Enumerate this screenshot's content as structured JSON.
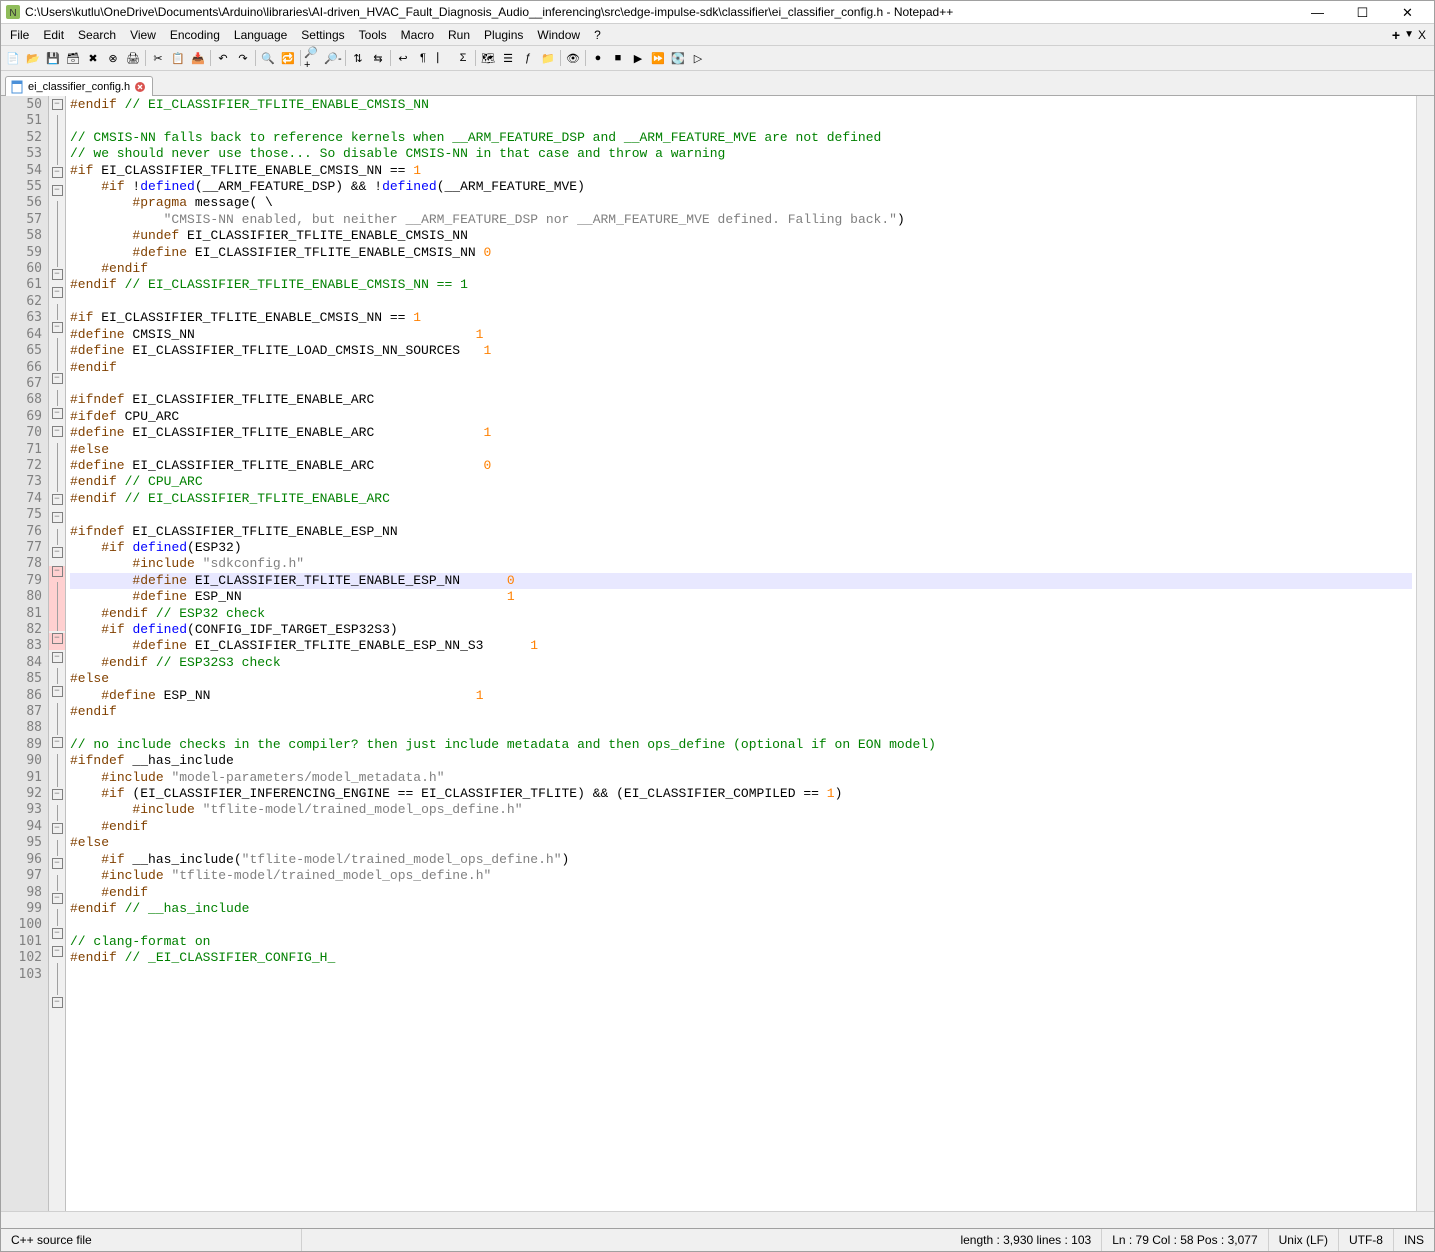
{
  "titlebar": {
    "title": "C:\\Users\\kutlu\\OneDrive\\Documents\\Arduino\\libraries\\AI-driven_HVAC_Fault_Diagnosis_Audio__inferencing\\src\\edge-impulse-sdk\\classifier\\ei_classifier_config.h - Notepad++"
  },
  "menu": {
    "items": [
      "File",
      "Edit",
      "Search",
      "View",
      "Encoding",
      "Language",
      "Settings",
      "Tools",
      "Macro",
      "Run",
      "Plugins",
      "Window",
      "?"
    ],
    "plus": "+",
    "caret": "▼",
    "close": "X"
  },
  "tab": {
    "label": "ei_classifier_config.h"
  },
  "editor": {
    "first_line": 50,
    "highlight_line": 79,
    "lines": [
      {
        "n": 50,
        "fold": "-",
        "seg": [
          [
            "pp",
            "#endif"
          ],
          [
            "id",
            " "
          ],
          [
            "cm",
            "// EI_CLASSIFIER_TFLITE_ENABLE_CMSIS_NN"
          ]
        ]
      },
      {
        "n": 51,
        "fold": "|",
        "seg": []
      },
      {
        "n": 52,
        "fold": "|",
        "seg": [
          [
            "cm",
            "// CMSIS-NN falls back to reference kernels when __ARM_FEATURE_DSP and __ARM_FEATURE_MVE are not defined"
          ]
        ]
      },
      {
        "n": 53,
        "fold": "|",
        "seg": [
          [
            "cm",
            "// we should never use those... So disable CMSIS-NN in that case and throw a warning"
          ]
        ]
      },
      {
        "n": 54,
        "fold": "-",
        "seg": [
          [
            "pp",
            "#if"
          ],
          [
            "id",
            " EI_CLASSIFIER_TFLITE_ENABLE_CMSIS_NN == "
          ],
          [
            "num",
            "1"
          ]
        ]
      },
      {
        "n": 55,
        "fold": "-",
        "seg": [
          [
            "id",
            "    "
          ],
          [
            "pp",
            "#if"
          ],
          [
            "id",
            " !"
          ],
          [
            "kw",
            "defined"
          ],
          [
            "id",
            "(__ARM_FEATURE_DSP) && !"
          ],
          [
            "kw",
            "defined"
          ],
          [
            "id",
            "(__ARM_FEATURE_MVE)"
          ]
        ]
      },
      {
        "n": 56,
        "fold": "|",
        "seg": [
          [
            "id",
            "        "
          ],
          [
            "pp",
            "#pragma"
          ],
          [
            "id",
            " message( \\"
          ]
        ]
      },
      {
        "n": 57,
        "fold": "|",
        "seg": [
          [
            "id",
            "            "
          ],
          [
            "str",
            "\"CMSIS-NN enabled, but neither __ARM_FEATURE_DSP nor __ARM_FEATURE_MVE defined. Falling back.\""
          ],
          [
            "id",
            ")"
          ]
        ]
      },
      {
        "n": 58,
        "fold": "|",
        "seg": [
          [
            "id",
            "        "
          ],
          [
            "pp",
            "#undef"
          ],
          [
            "id",
            " EI_CLASSIFIER_TFLITE_ENABLE_CMSIS_NN"
          ]
        ]
      },
      {
        "n": 59,
        "fold": "|",
        "seg": [
          [
            "id",
            "        "
          ],
          [
            "pp",
            "#define"
          ],
          [
            "id",
            " EI_CLASSIFIER_TFLITE_ENABLE_CMSIS_NN "
          ],
          [
            "num",
            "0"
          ]
        ]
      },
      {
        "n": 60,
        "fold": "-",
        "seg": [
          [
            "id",
            "    "
          ],
          [
            "pp",
            "#endif"
          ]
        ]
      },
      {
        "n": 61,
        "fold": "-",
        "seg": [
          [
            "pp",
            "#endif"
          ],
          [
            "id",
            " "
          ],
          [
            "cm",
            "// EI_CLASSIFIER_TFLITE_ENABLE_CMSIS_NN == 1"
          ]
        ]
      },
      {
        "n": 62,
        "fold": "|",
        "seg": []
      },
      {
        "n": 63,
        "fold": "-",
        "seg": [
          [
            "pp",
            "#if"
          ],
          [
            "id",
            " EI_CLASSIFIER_TFLITE_ENABLE_CMSIS_NN == "
          ],
          [
            "num",
            "1"
          ]
        ]
      },
      {
        "n": 64,
        "fold": "|",
        "seg": [
          [
            "pp",
            "#define"
          ],
          [
            "id",
            " CMSIS_NN                                    "
          ],
          [
            "num",
            "1"
          ]
        ]
      },
      {
        "n": 65,
        "fold": "|",
        "seg": [
          [
            "pp",
            "#define"
          ],
          [
            "id",
            " EI_CLASSIFIER_TFLITE_LOAD_CMSIS_NN_SOURCES   "
          ],
          [
            "num",
            "1"
          ]
        ]
      },
      {
        "n": 66,
        "fold": "-",
        "seg": [
          [
            "pp",
            "#endif"
          ]
        ]
      },
      {
        "n": 67,
        "fold": "|",
        "seg": []
      },
      {
        "n": 68,
        "fold": "-",
        "seg": [
          [
            "pp",
            "#ifndef"
          ],
          [
            "id",
            " EI_CLASSIFIER_TFLITE_ENABLE_ARC"
          ]
        ]
      },
      {
        "n": 69,
        "fold": "-",
        "seg": [
          [
            "pp",
            "#ifdef"
          ],
          [
            "id",
            " CPU_ARC"
          ]
        ]
      },
      {
        "n": 70,
        "fold": "|",
        "seg": [
          [
            "pp",
            "#define"
          ],
          [
            "id",
            " EI_CLASSIFIER_TFLITE_ENABLE_ARC              "
          ],
          [
            "num",
            "1"
          ]
        ]
      },
      {
        "n": 71,
        "fold": "|",
        "seg": [
          [
            "pp",
            "#else"
          ]
        ]
      },
      {
        "n": 72,
        "fold": "|",
        "seg": [
          [
            "pp",
            "#define"
          ],
          [
            "id",
            " EI_CLASSIFIER_TFLITE_ENABLE_ARC              "
          ],
          [
            "num",
            "0"
          ]
        ]
      },
      {
        "n": 73,
        "fold": "-",
        "seg": [
          [
            "pp",
            "#endif"
          ],
          [
            "id",
            " "
          ],
          [
            "cm",
            "// CPU_ARC"
          ]
        ]
      },
      {
        "n": 74,
        "fold": "-",
        "seg": [
          [
            "pp",
            "#endif"
          ],
          [
            "id",
            " "
          ],
          [
            "cm",
            "// EI_CLASSIFIER_TFLITE_ENABLE_ARC"
          ]
        ]
      },
      {
        "n": 75,
        "fold": "|",
        "seg": []
      },
      {
        "n": 76,
        "fold": "-",
        "seg": [
          [
            "pp",
            "#ifndef"
          ],
          [
            "id",
            " EI_CLASSIFIER_TFLITE_ENABLE_ESP_NN"
          ]
        ]
      },
      {
        "n": 77,
        "fold": "-r",
        "seg": [
          [
            "id",
            "    "
          ],
          [
            "pp",
            "#if"
          ],
          [
            "id",
            " "
          ],
          [
            "kw",
            "defined"
          ],
          [
            "id",
            "(ESP32)"
          ]
        ]
      },
      {
        "n": 78,
        "fold": "|r",
        "seg": [
          [
            "id",
            "        "
          ],
          [
            "pp",
            "#include"
          ],
          [
            "id",
            " "
          ],
          [
            "str",
            "\"sdkconfig.h\""
          ]
        ]
      },
      {
        "n": 79,
        "fold": "|r",
        "seg": [
          [
            "id",
            "        "
          ],
          [
            "pp",
            "#define"
          ],
          [
            "id",
            " EI_CLASSIFIER_TFLITE_ENABLE_ESP_NN      "
          ],
          [
            "num",
            "0"
          ]
        ]
      },
      {
        "n": 80,
        "fold": "|r",
        "seg": [
          [
            "id",
            "        "
          ],
          [
            "pp",
            "#define"
          ],
          [
            "id",
            " ESP_NN                                  "
          ],
          [
            "num",
            "1"
          ]
        ]
      },
      {
        "n": 81,
        "fold": "-r",
        "seg": [
          [
            "id",
            "    "
          ],
          [
            "pp",
            "#endif"
          ],
          [
            "id",
            " "
          ],
          [
            "cm",
            "// ESP32 check"
          ]
        ]
      },
      {
        "n": 82,
        "fold": "-",
        "seg": [
          [
            "id",
            "    "
          ],
          [
            "pp",
            "#if"
          ],
          [
            "id",
            " "
          ],
          [
            "kw",
            "defined"
          ],
          [
            "id",
            "(CONFIG_IDF_TARGET_ESP32S3)"
          ]
        ]
      },
      {
        "n": 83,
        "fold": "|",
        "seg": [
          [
            "id",
            "        "
          ],
          [
            "pp",
            "#define"
          ],
          [
            "id",
            " EI_CLASSIFIER_TFLITE_ENABLE_ESP_NN_S3      "
          ],
          [
            "num",
            "1"
          ]
        ]
      },
      {
        "n": 84,
        "fold": "-",
        "seg": [
          [
            "id",
            "    "
          ],
          [
            "pp",
            "#endif"
          ],
          [
            "id",
            " "
          ],
          [
            "cm",
            "// ESP32S3 check"
          ]
        ]
      },
      {
        "n": 85,
        "fold": "|",
        "seg": [
          [
            "pp",
            "#else"
          ]
        ]
      },
      {
        "n": 86,
        "fold": "|",
        "seg": [
          [
            "id",
            "    "
          ],
          [
            "pp",
            "#define"
          ],
          [
            "id",
            " ESP_NN                                  "
          ],
          [
            "num",
            "1"
          ]
        ]
      },
      {
        "n": 87,
        "fold": "-",
        "seg": [
          [
            "pp",
            "#endif"
          ]
        ]
      },
      {
        "n": 88,
        "fold": "|",
        "seg": []
      },
      {
        "n": 89,
        "fold": "|",
        "seg": [
          [
            "cm",
            "// no include checks in the compiler? then just include metadata and then ops_define (optional if on EON model)"
          ]
        ]
      },
      {
        "n": 90,
        "fold": "-",
        "seg": [
          [
            "pp",
            "#ifndef"
          ],
          [
            "id",
            " __has_include"
          ]
        ]
      },
      {
        "n": 91,
        "fold": "|",
        "seg": [
          [
            "id",
            "    "
          ],
          [
            "pp",
            "#include"
          ],
          [
            "id",
            " "
          ],
          [
            "str",
            "\"model-parameters/model_metadata.h\""
          ]
        ]
      },
      {
        "n": 92,
        "fold": "-",
        "seg": [
          [
            "id",
            "    "
          ],
          [
            "pp",
            "#if"
          ],
          [
            "id",
            " (EI_CLASSIFIER_INFERENCING_ENGINE == EI_CLASSIFIER_TFLITE) && (EI_CLASSIFIER_COMPILED == "
          ],
          [
            "num",
            "1"
          ],
          [
            "id",
            ")"
          ]
        ]
      },
      {
        "n": 93,
        "fold": "|",
        "seg": [
          [
            "id",
            "        "
          ],
          [
            "pp",
            "#include"
          ],
          [
            "id",
            " "
          ],
          [
            "str",
            "\"tflite-model/trained_model_ops_define.h\""
          ]
        ]
      },
      {
        "n": 94,
        "fold": "-",
        "seg": [
          [
            "id",
            "    "
          ],
          [
            "pp",
            "#endif"
          ]
        ]
      },
      {
        "n": 95,
        "fold": "|",
        "seg": [
          [
            "pp",
            "#else"
          ]
        ]
      },
      {
        "n": 96,
        "fold": "-",
        "seg": [
          [
            "id",
            "    "
          ],
          [
            "pp",
            "#if"
          ],
          [
            "id",
            " __has_include("
          ],
          [
            "str",
            "\"tflite-model/trained_model_ops_define.h\""
          ],
          [
            "id",
            ")"
          ]
        ]
      },
      {
        "n": 97,
        "fold": "|",
        "seg": [
          [
            "id",
            "    "
          ],
          [
            "pp",
            "#include"
          ],
          [
            "id",
            " "
          ],
          [
            "str",
            "\"tflite-model/trained_model_ops_define.h\""
          ]
        ]
      },
      {
        "n": 98,
        "fold": "-",
        "seg": [
          [
            "id",
            "    "
          ],
          [
            "pp",
            "#endif"
          ]
        ]
      },
      {
        "n": 99,
        "fold": "-",
        "seg": [
          [
            "pp",
            "#endif"
          ],
          [
            "id",
            " "
          ],
          [
            "cm",
            "// __has_include"
          ]
        ]
      },
      {
        "n": 100,
        "fold": "|",
        "seg": []
      },
      {
        "n": 101,
        "fold": "|",
        "seg": [
          [
            "cm",
            "// clang-format on"
          ]
        ]
      },
      {
        "n": 102,
        "fold": "-",
        "seg": [
          [
            "pp",
            "#endif"
          ],
          [
            "id",
            " "
          ],
          [
            "cm",
            "// _EI_CLASSIFIER_CONFIG_H_"
          ]
        ]
      },
      {
        "n": 103,
        "fold": "",
        "seg": []
      }
    ]
  },
  "statusbar": {
    "filetype": "C++ source file",
    "length": "length : 3,930    lines : 103",
    "pos": "Ln : 79    Col : 58    Pos : 3,077",
    "eol": "Unix (LF)",
    "encoding": "UTF-8",
    "ins": "INS"
  },
  "toolbar_icons": [
    {
      "name": "new-file-icon",
      "glyph": "📄"
    },
    {
      "name": "open-file-icon",
      "glyph": "📂"
    },
    {
      "name": "save-icon",
      "glyph": "💾"
    },
    {
      "name": "save-all-icon",
      "glyph": "🗃"
    },
    {
      "name": "close-icon",
      "glyph": "✖"
    },
    {
      "name": "close-all-icon",
      "glyph": "⊗"
    },
    {
      "name": "print-icon",
      "glyph": "🖨"
    },
    {
      "name": "sep"
    },
    {
      "name": "cut-icon",
      "glyph": "✂"
    },
    {
      "name": "copy-icon",
      "glyph": "📋"
    },
    {
      "name": "paste-icon",
      "glyph": "📥"
    },
    {
      "name": "sep"
    },
    {
      "name": "undo-icon",
      "glyph": "↶"
    },
    {
      "name": "redo-icon",
      "glyph": "↷"
    },
    {
      "name": "sep"
    },
    {
      "name": "find-icon",
      "glyph": "🔍"
    },
    {
      "name": "replace-icon",
      "glyph": "🔁"
    },
    {
      "name": "sep"
    },
    {
      "name": "zoom-in-icon",
      "glyph": "🔎+"
    },
    {
      "name": "zoom-out-icon",
      "glyph": "🔎-"
    },
    {
      "name": "sep"
    },
    {
      "name": "sync-v-icon",
      "glyph": "⇅"
    },
    {
      "name": "sync-h-icon",
      "glyph": "⇆"
    },
    {
      "name": "sep"
    },
    {
      "name": "wordwrap-icon",
      "glyph": "↩"
    },
    {
      "name": "whitespace-icon",
      "glyph": "¶"
    },
    {
      "name": "indent-guide-icon",
      "glyph": "⎸"
    },
    {
      "name": "lang-icon",
      "glyph": "Σ"
    },
    {
      "name": "sep"
    },
    {
      "name": "doc-map-icon",
      "glyph": "🗺"
    },
    {
      "name": "doc-list-icon",
      "glyph": "☰"
    },
    {
      "name": "func-list-icon",
      "glyph": "ƒ"
    },
    {
      "name": "folder-icon",
      "glyph": "📁"
    },
    {
      "name": "sep"
    },
    {
      "name": "monitor-icon",
      "glyph": "👁"
    },
    {
      "name": "sep"
    },
    {
      "name": "record-icon",
      "glyph": "●"
    },
    {
      "name": "stop-icon",
      "glyph": "■"
    },
    {
      "name": "play-icon",
      "glyph": "▶"
    },
    {
      "name": "play-multi-icon",
      "glyph": "⏩"
    },
    {
      "name": "save-macro-icon",
      "glyph": "💽"
    },
    {
      "name": "run-macro-icon",
      "glyph": "▷"
    }
  ]
}
